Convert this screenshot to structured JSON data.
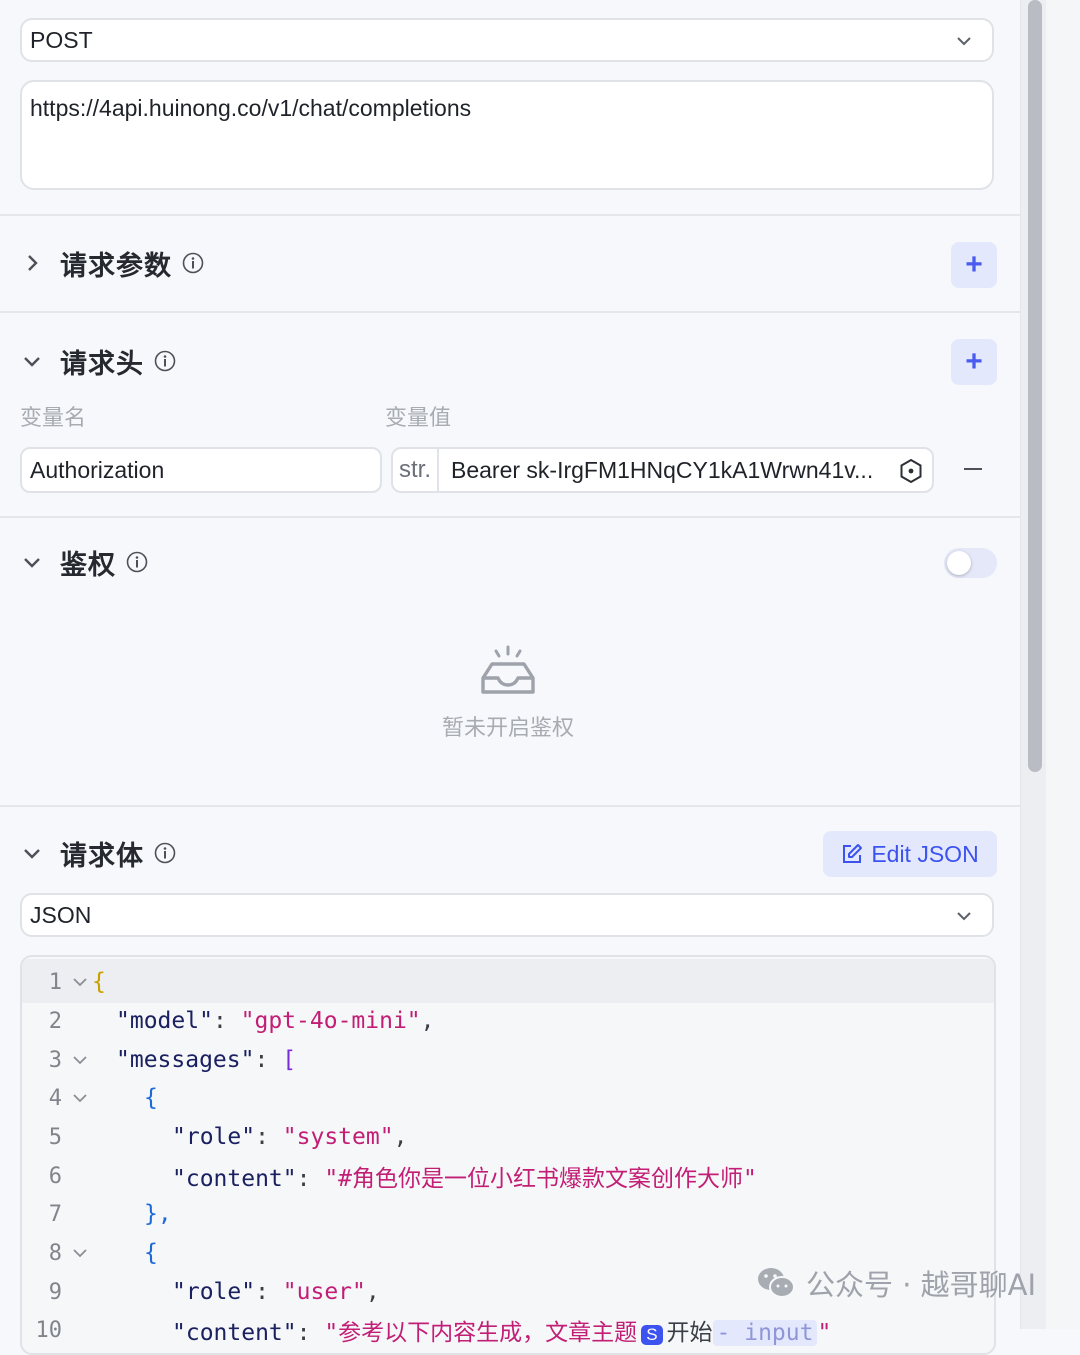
{
  "request": {
    "method": "POST",
    "url": "https://4api.huinong.co/v1/chat/completions"
  },
  "sections": {
    "params": {
      "title": "请求参数",
      "expanded": false
    },
    "headers": {
      "title": "请求头",
      "expanded": true,
      "col_name": "变量名",
      "col_value": "变量值",
      "rows": [
        {
          "name": "Authorization",
          "type_tag": "str.",
          "value": "Bearer sk-IrgFM1HNqCY1kA1Wrwn41v..."
        }
      ]
    },
    "auth": {
      "title": "鉴权",
      "enabled": false,
      "empty_text": "暂未开启鉴权"
    },
    "body": {
      "title": "请求体",
      "edit_json_label": "Edit JSON",
      "format": "JSON"
    }
  },
  "code_lines": [
    {
      "n": "1",
      "fold": true
    },
    {
      "n": "2",
      "fold": false
    },
    {
      "n": "3",
      "fold": true
    },
    {
      "n": "4",
      "fold": true
    },
    {
      "n": "5",
      "fold": false
    },
    {
      "n": "6",
      "fold": false
    },
    {
      "n": "7",
      "fold": false
    },
    {
      "n": "8",
      "fold": true
    },
    {
      "n": "9",
      "fold": false
    },
    {
      "n": "10",
      "fold": false
    }
  ],
  "code": {
    "l1": "{",
    "l2_key": "\"model\"",
    "l2_val": "\"gpt-4o-mini\"",
    "l3_key": "\"messages\"",
    "l3_br": "[",
    "l4": "{",
    "l5_key": "\"role\"",
    "l5_val": "\"system\"",
    "l6_key": "\"content\"",
    "l6_val": "\"#角色你是一位小红书爆款文案创作大师\"",
    "l7": "},",
    "l8": "{",
    "l9_key": "\"role\"",
    "l9_val": "\"user\"",
    "l10_key": "\"content\"",
    "l10_val": "\"参考以下内容生成，文章主题",
    "l10_chip": "S",
    "l10_node": "开始",
    "l10_var": "- input",
    "l10_end": "\""
  },
  "watermark": "公众号 · 越哥聊AI",
  "colors": {
    "accent": "#3c53f0",
    "accent_bg": "#e3e8fd",
    "string": "#c21e75",
    "key": "#1a2060"
  }
}
